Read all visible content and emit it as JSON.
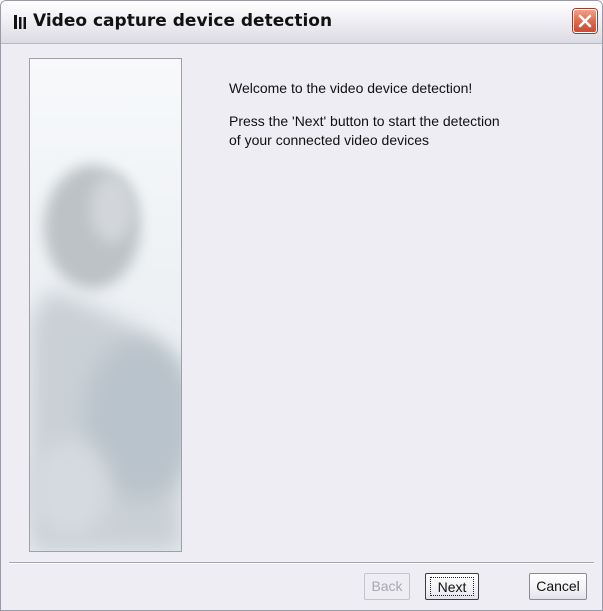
{
  "window": {
    "title": "Video capture device detection",
    "icon": "app-bars-icon",
    "close_icon": "close-icon"
  },
  "content": {
    "welcome": "Welcome to the video device detection!",
    "instruction_line1": "Press the 'Next' button to start the detection",
    "instruction_line2": "of your connected video devices"
  },
  "buttons": {
    "back": {
      "label": "Back",
      "enabled": false
    },
    "next": {
      "label": "Next",
      "enabled": true,
      "focused": true
    },
    "cancel": {
      "label": "Cancel",
      "enabled": true
    }
  },
  "colors": {
    "window_bg": "#eeedf3",
    "close_button": "#e06a4e",
    "text": "#111111",
    "disabled_text": "#a8a8b0"
  }
}
